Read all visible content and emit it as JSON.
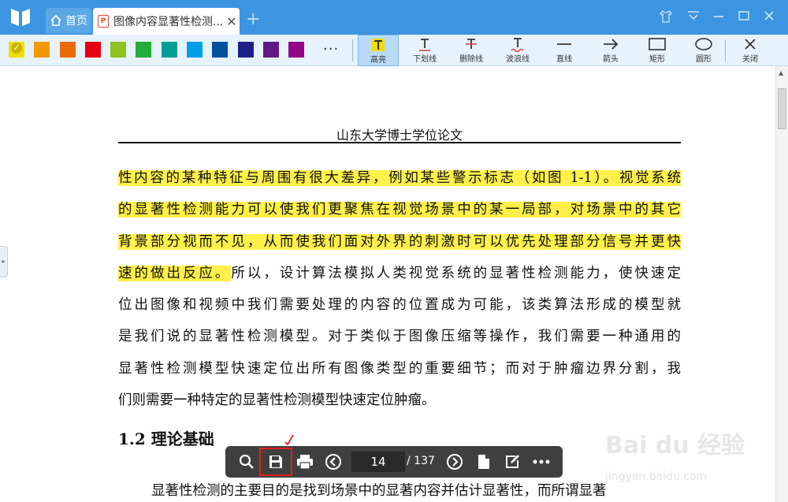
{
  "titlebar": {
    "home_tab_label": "首页",
    "doc_tab_title": "图像内容显著性检测...",
    "doc_tab_icon": "pdf-icon",
    "window_controls": [
      "skin-icon",
      "menu-icon",
      "minimize-icon",
      "maximize-icon",
      "close-icon"
    ]
  },
  "annotation_toolbar": {
    "colors": [
      "#f2de00",
      "#f39800",
      "#ea6a0a",
      "#e60012",
      "#8fc31f",
      "#22ac38",
      "#009e96",
      "#00a0e9",
      "#0050a0",
      "#1d2088",
      "#601986",
      "#920783"
    ],
    "selected_color": "#f2de00",
    "more_label": "···",
    "tools": [
      {
        "label": "高亮",
        "icon": "highlight-icon",
        "active": true
      },
      {
        "label": "下划线",
        "icon": "underline-icon"
      },
      {
        "label": "删除线",
        "icon": "strikethrough-icon"
      },
      {
        "label": "波浪线",
        "icon": "wavy-line-icon"
      },
      {
        "label": "直线",
        "icon": "line-icon"
      },
      {
        "label": "箭头",
        "icon": "arrow-icon"
      },
      {
        "label": "矩形",
        "icon": "rectangle-icon"
      },
      {
        "label": "圆形",
        "icon": "circle-icon"
      },
      {
        "label": "关闭",
        "icon": "close-icon"
      }
    ]
  },
  "document": {
    "running_head": "山东大学博士学位论文",
    "para1_lines": [
      "性内容的某种特征与周围有很大差异，例如某些警示标志（如图 1-1）。视觉系统",
      "的显著性检测能力可以使我们更聚焦在视觉场景中的某一局部，对场景中的其它",
      "背景部分视而不见，从而使我们面对外界的刺激时可以优先处理部分信号并更快",
      "所以，设计算法模拟人类视觉系统的显著性检测能力，使快速定",
      "位出图像和视频中我们需要处理的内容的位置成为可能，该类算法形成的模型就",
      "是我们说的显著性检测模型。对于类似于图像压缩等操作，我们需要一种通用的",
      "显著性检测模型快速定位出所有图像类型的重要细节；而对于肿瘤边界分割，我",
      "们则需要一种特定的显著性检测模型快速定位肿瘤。"
    ],
    "line4_highlighted": "速的做出反应。",
    "section_heading": "1.2 理论基础",
    "para2_first_line": "显著性检测的主要目的是找到场景中的显著内容并估计显著性，而所谓显著"
  },
  "bottom_toolbar": {
    "current_page": "14",
    "total_pages": "/ 137",
    "buttons": [
      "search-icon",
      "save-icon",
      "print-icon",
      "prev-page-icon",
      "next-page-icon",
      "page-icon",
      "edit-icon",
      "more-icon"
    ]
  },
  "watermark": {
    "brand": "Bai du 经验",
    "url": "jingyan.baidu.com"
  }
}
